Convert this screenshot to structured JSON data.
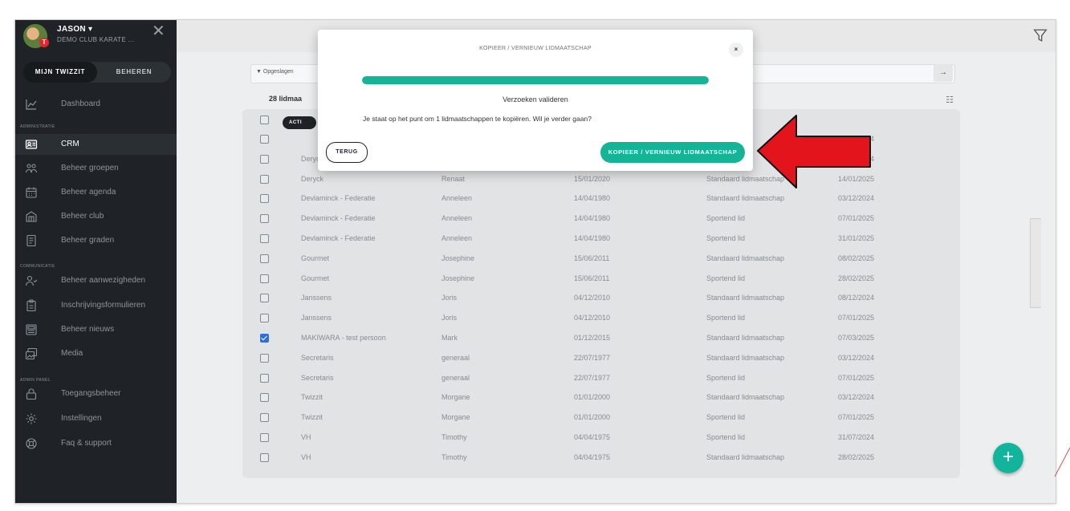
{
  "sidebar": {
    "user_name": "JASON ▾",
    "club_name": "DEMO CLUB KARATE ...",
    "avatar_badge": "T",
    "tabs": [
      {
        "label": "MIJN TWIZZIT"
      },
      {
        "label": "BEHEREN"
      }
    ],
    "sections": {
      "administratie": "ADMINISTRATIE",
      "communicatie": "COMMUNICATIE",
      "admin_panel": "ADMIN PANEL"
    },
    "items": [
      {
        "label": "Dashboard",
        "icon": "chart-line-icon"
      },
      {
        "label": "CRM",
        "icon": "id-card-icon"
      },
      {
        "label": "Beheer groepen",
        "icon": "users-group-icon"
      },
      {
        "label": "Beheer agenda",
        "icon": "calendar-icon"
      },
      {
        "label": "Beheer club",
        "icon": "building-icon"
      },
      {
        "label": "Beheer graden",
        "icon": "document-icon"
      },
      {
        "label": "Beheer aanwezigheden",
        "icon": "user-check-icon"
      },
      {
        "label": "Inschrijvingsformulieren",
        "icon": "clipboard-icon"
      },
      {
        "label": "Beheer nieuws",
        "icon": "newspaper-icon"
      },
      {
        "label": "Media",
        "icon": "images-icon"
      },
      {
        "label": "Toegangsbeheer",
        "icon": "lock-icon"
      },
      {
        "label": "Instellingen",
        "icon": "gear-icon"
      },
      {
        "label": "Faq & support",
        "icon": "support-icon"
      }
    ]
  },
  "toolbar": {
    "filter_label": "Opgeslagen",
    "count_label": "28 lidmaa",
    "actions_label": "ACTI"
  },
  "table": {
    "rows": [
      {
        "last": "",
        "first": "",
        "birth": "",
        "type": "Sportend lid",
        "date": "31/07/2024",
        "checked": false
      },
      {
        "last": "Deryck",
        "first": "Renaat",
        "birth": "15/01/2020",
        "type": "Sportend lid",
        "date": "31/07/2024",
        "checked": false
      },
      {
        "last": "Deryck",
        "first": "Renaat",
        "birth": "15/01/2020",
        "type": "Standaard lidmaatschap",
        "date": "14/01/2025",
        "checked": false
      },
      {
        "last": "Devlaminck - Federatie",
        "first": "Anneleen",
        "birth": "14/04/1980",
        "type": "Standaard lidmaatschap",
        "date": "03/12/2024",
        "checked": false
      },
      {
        "last": "Devlaminck - Federatie",
        "first": "Anneleen",
        "birth": "14/04/1980",
        "type": "Sportend lid",
        "date": "07/01/2025",
        "checked": false
      },
      {
        "last": "Devlaminck - Federatie",
        "first": "Anneleen",
        "birth": "14/04/1980",
        "type": "Sportend lid",
        "date": "31/01/2025",
        "checked": false
      },
      {
        "last": "Gourmet",
        "first": "Josephine",
        "birth": "15/06/2011",
        "type": "Standaard lidmaatschap",
        "date": "08/02/2025",
        "checked": false
      },
      {
        "last": "Gourmet",
        "first": "Josephine",
        "birth": "15/06/2011",
        "type": "Sportend lid",
        "date": "28/02/2025",
        "checked": false
      },
      {
        "last": "Janssens",
        "first": "Joris",
        "birth": "04/12/2010",
        "type": "Standaard lidmaatschap",
        "date": "08/12/2024",
        "checked": false
      },
      {
        "last": "Janssens",
        "first": "Joris",
        "birth": "04/12/2010",
        "type": "Sportend lid",
        "date": "07/01/2025",
        "checked": false
      },
      {
        "last": "MAKIWARA - test persoon",
        "first": "Mark",
        "birth": "01/12/2015",
        "type": "Standaard lidmaatschap",
        "date": "07/03/2025",
        "checked": true
      },
      {
        "last": "Secretaris",
        "first": "generaal",
        "birth": "22/07/1977",
        "type": "Standaard lidmaatschap",
        "date": "03/12/2024",
        "checked": false
      },
      {
        "last": "Secretaris",
        "first": "generaal",
        "birth": "22/07/1977",
        "type": "Sportend lid",
        "date": "07/01/2025",
        "checked": false
      },
      {
        "last": "Twizzit",
        "first": "Morgane",
        "birth": "01/01/2000",
        "type": "Standaard lidmaatschap",
        "date": "03/12/2024",
        "checked": false
      },
      {
        "last": "Twizzit",
        "first": "Morgane",
        "birth": "01/01/2000",
        "type": "Sportend lid",
        "date": "07/01/2025",
        "checked": false
      },
      {
        "last": "VH",
        "first": "Timothy",
        "birth": "04/04/1975",
        "type": "Sportend lid",
        "date": "31/07/2024",
        "checked": false
      },
      {
        "last": "VH",
        "first": "Timothy",
        "birth": "04/04/1975",
        "type": "Standaard lidmaatschap",
        "date": "28/02/2025",
        "checked": false
      }
    ]
  },
  "modal": {
    "title": "KOPIEER / VERNIEUW LIDMAATSCHAP",
    "close_label": "×",
    "progress_fraction": 1.0,
    "status": "Verzoeken valideren",
    "question": "Je staat op het punt om 1 lidmaatschappen te kopiëren. Wil je verder gaan?",
    "back_label": "TERUG",
    "confirm_label": "KOPIEER / VERNIEUW LIDMAATSCHAP"
  },
  "fab_label": "+",
  "colors": {
    "accent": "#13b596",
    "sidebar": "#1f2327",
    "annotation_arrow": "#e3141b"
  }
}
